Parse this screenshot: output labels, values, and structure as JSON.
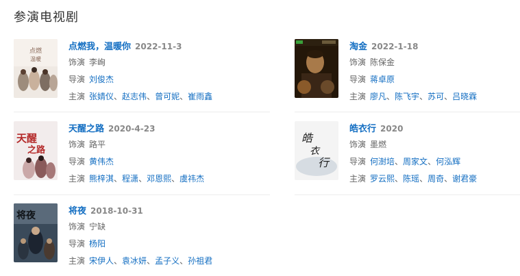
{
  "section": {
    "title": "参演电视剧"
  },
  "works": [
    {
      "title": "点燃我，温暖你",
      "date": "2022-11-3",
      "role_label": "饰演",
      "role": "李峋",
      "director_label": "导演",
      "directors": [
        "刘俊杰"
      ],
      "cast_label": "主演",
      "cast": [
        "张婧仪",
        "赵志伟",
        "曾可妮",
        "崔雨鑫"
      ],
      "poster": {
        "icon": "poster-image",
        "colors": [
          "#f1ece6",
          "#d9cfc6",
          "#8a7a6a"
        ]
      }
    },
    {
      "title": "淘金",
      "date": "2022-1-18",
      "role_label": "饰演",
      "role": "陈保金",
      "director_label": "导演",
      "directors": [
        "蒋卓原"
      ],
      "cast_label": "主演",
      "cast": [
        "廖凡",
        "陈飞宇",
        "苏可",
        "吕晓霖"
      ],
      "poster": {
        "icon": "poster-image",
        "colors": [
          "#2a1c10",
          "#6b4a2a",
          "#c89a5a"
        ]
      }
    },
    {
      "title": "天醒之路",
      "date": "2020-4-23",
      "role_label": "饰演",
      "role": "路平",
      "director_label": "导演",
      "directors": [
        "黄伟杰"
      ],
      "cast_label": "主演",
      "cast": [
        "熊梓淇",
        "程潇",
        "邓恩熙",
        "虞祎杰"
      ],
      "poster": {
        "icon": "poster-image",
        "colors": [
          "#f2ecec",
          "#d8c4c4",
          "#b42a2a"
        ]
      }
    },
    {
      "title": "皓衣行",
      "date": "2020",
      "role_label": "饰演",
      "role": "墨燃",
      "director_label": "导演",
      "directors": [
        "何澍培",
        "周家文",
        "何泓辉"
      ],
      "cast_label": "主演",
      "cast": [
        "罗云熙",
        "陈瑶",
        "周奇",
        "谢君豪"
      ],
      "poster": {
        "icon": "poster-image",
        "colors": [
          "#f3f3f3",
          "#c9cfd6",
          "#2a2a2a"
        ]
      }
    },
    {
      "title": "将夜",
      "date": "2018-10-31",
      "role_label": "饰演",
      "role": "宁缺",
      "director_label": "导演",
      "directors": [
        "杨阳"
      ],
      "cast_label": "主演",
      "cast": [
        "宋伊人",
        "袁冰妍",
        "孟子义",
        "孙祖君"
      ],
      "poster": {
        "icon": "poster-image",
        "colors": [
          "#3a4a5a",
          "#7a8898",
          "#1c2430"
        ]
      }
    }
  ]
}
